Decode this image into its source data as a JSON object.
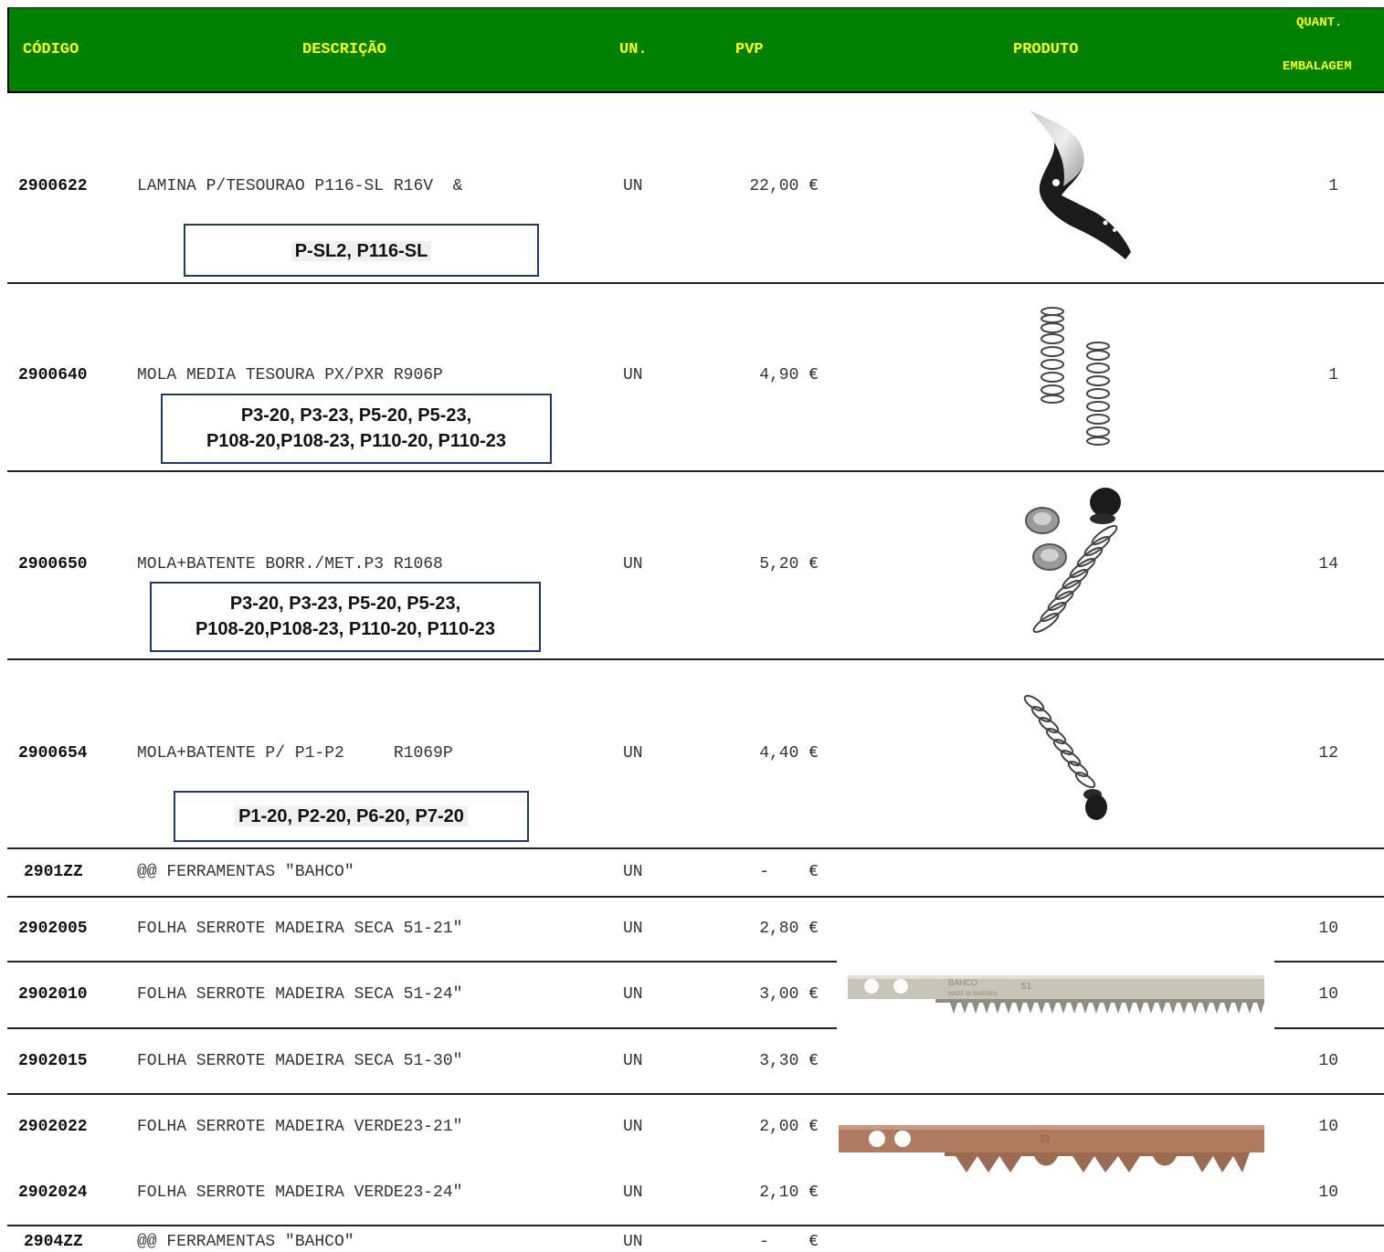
{
  "header": {
    "codigo": "CÓDIGO",
    "descricao": "DESCRIÇÃO",
    "un": "UN.",
    "pvp": "PVP",
    "produto": "PRODUTO",
    "quant": "QUANT.",
    "embalagem": "EMBALAGEM"
  },
  "rows": [
    {
      "code": "2900622",
      "desc": "LAMINA P/TESOURAO P116-SL R16V  &",
      "un": "UN",
      "pvp": "22,00 €",
      "qty": "1",
      "models": [
        "P-SL2, P116-SL"
      ],
      "image": "pruner-blade"
    },
    {
      "code": "2900640",
      "desc": "MOLA MEDIA TESOURA PX/PXR R906P",
      "un": "UN",
      "pvp": "4,90 €",
      "qty": "1",
      "models": [
        "P3-20, P3-23, P5-20, P5-23,",
        "P108-20,P108-23, P110-20, P110-23"
      ],
      "image": "springs"
    },
    {
      "code": "2900650",
      "desc": "MOLA+BATENTE BORR./MET.P3 R1068",
      "un": "UN",
      "pvp": "5,20 €",
      "qty": "14",
      "models": [
        "P3-20, P3-23, P5-20, P5-23,",
        "P108-20,P108-23, P110-20, P110-23"
      ],
      "image": "spring-with-stops"
    },
    {
      "code": "2900654",
      "desc": "MOLA+BATENTE P/ P1-P2     R1069P",
      "un": "UN",
      "pvp": "4,40 €",
      "qty": "12",
      "models": [
        "P1-20, P2-20, P6-20, P7-20"
      ],
      "image": "spring-with-bumper"
    },
    {
      "code": "2901ZZ",
      "desc": "@@ FERRAMENTAS \"BAHCO\"",
      "un": "UN",
      "pvp": "-    €",
      "qty": ""
    },
    {
      "code": "2902005",
      "desc": "FOLHA SERROTE MADEIRA SECA 51-21\"",
      "un": "UN",
      "pvp": "2,80 €",
      "qty": "10"
    },
    {
      "code": "2902010",
      "desc": "FOLHA SERROTE MADEIRA SECA 51-24\"",
      "un": "UN",
      "pvp": "3,00 €",
      "qty": "10"
    },
    {
      "code": "2902015",
      "desc": "FOLHA SERROTE MADEIRA SECA 51-30\"",
      "un": "UN",
      "pvp": "3,30 €",
      "qty": "10"
    },
    {
      "code": "2902022",
      "desc": "FOLHA SERROTE MADEIRA VERDE23-21\"",
      "un": "UN",
      "pvp": "2,00 €",
      "qty": "10"
    },
    {
      "code": "2902024",
      "desc": "FOLHA SERROTE MADEIRA VERDE23-24\"",
      "un": "UN",
      "pvp": "2,10 €",
      "qty": "10"
    },
    {
      "code": "2904ZZ",
      "desc": "@@ FERRAMENTAS \"BAHCO\"",
      "un": "UN",
      "pvp": "-    €",
      "qty": ""
    }
  ],
  "images": {
    "saw_blade_dry": {
      "brand": "BAHCO",
      "model": "51",
      "made_in": "MADE IN SWEDEN"
    },
    "saw_blade_green": {
      "model": "23"
    }
  }
}
